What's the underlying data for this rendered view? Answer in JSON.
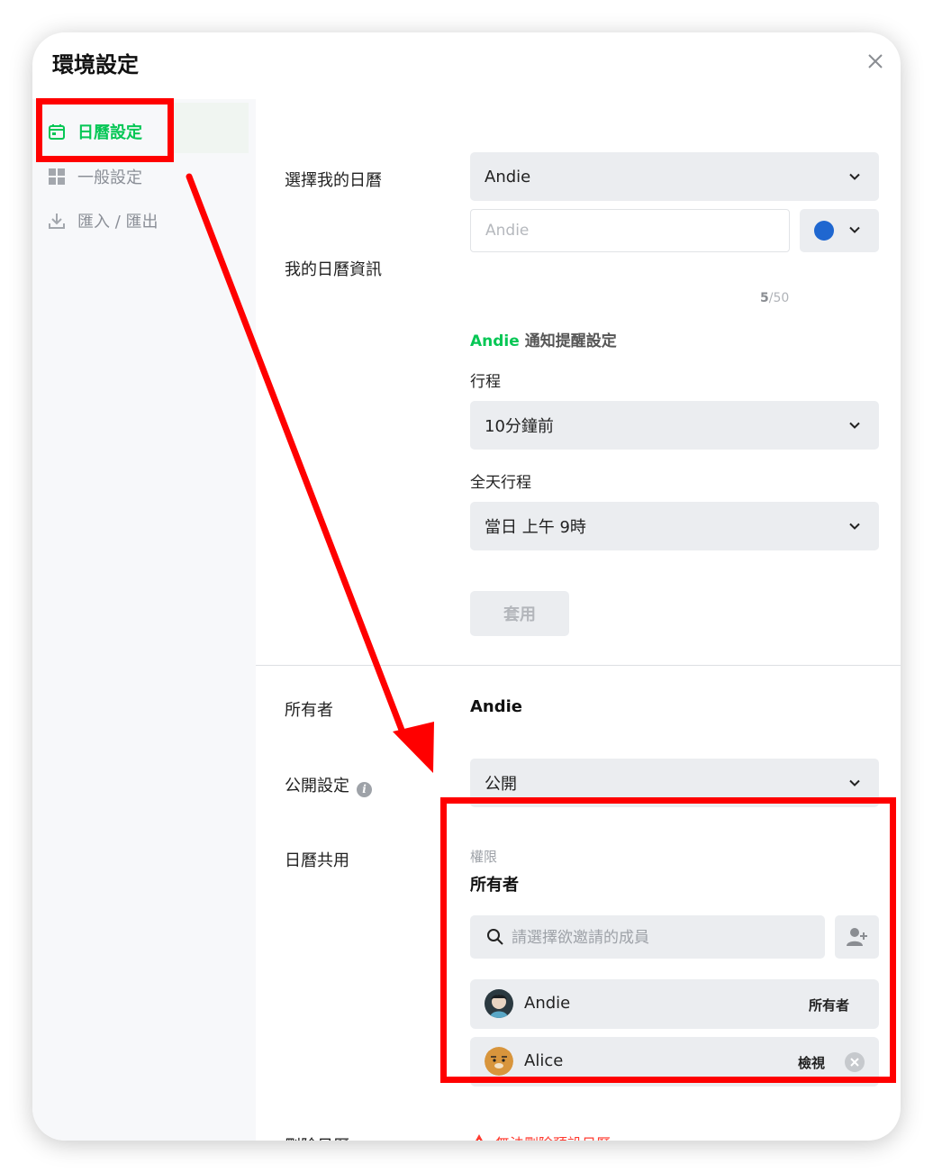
{
  "modal": {
    "title": "環境設定",
    "close_icon": "close-icon"
  },
  "sidebar": {
    "items": [
      {
        "label": "日曆設定",
        "icon": "calendar-icon",
        "active": true
      },
      {
        "label": "一般設定",
        "icon": "grid-icon",
        "active": false
      },
      {
        "label": "匯入 / 匯出",
        "icon": "download-icon",
        "active": false
      }
    ]
  },
  "calendar": {
    "select_label": "選擇我的日曆",
    "selected_calendar": "Andie",
    "info_label": "我的日曆資訊",
    "name_value": "",
    "name_placeholder": "Andie",
    "counter_current": "5",
    "counter_max": "/50",
    "color": "#1f67d0",
    "notification_name": "Andie",
    "notification_title": " 通知提醒設定",
    "event_label": "行程",
    "event_reminder": "10分鐘前",
    "allday_label": "全天行程",
    "allday_reminder": "當日 上午 9時",
    "apply_label": "套用"
  },
  "ownership": {
    "owner_label": "所有者",
    "owner_value": "Andie",
    "public_label": "公開設定",
    "public_value": "公開",
    "share_label": "日曆共用",
    "permission_caption": "權限",
    "permission_value": "所有者",
    "search_placeholder": "請選擇欲邀請的成員",
    "members": [
      {
        "name": "Andie",
        "role": "所有者"
      },
      {
        "name": "Alice",
        "role": "檢視"
      }
    ]
  },
  "delete": {
    "label": "刪除日曆",
    "warning": "無法刪除預設日曆"
  },
  "colors": {
    "accent": "#06c755",
    "danger": "#ff3b30",
    "annotation": "#ff0000"
  }
}
